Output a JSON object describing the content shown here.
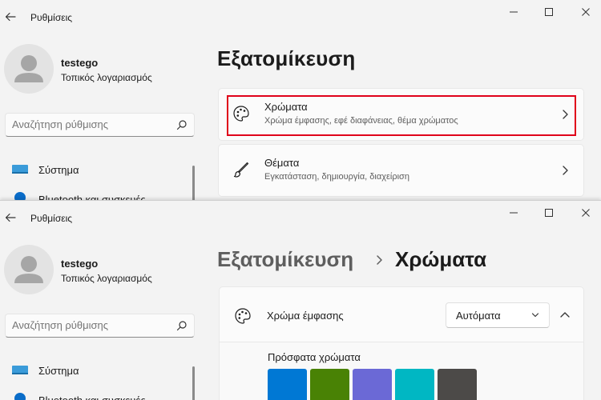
{
  "app_title": "Ρυθμίσεις",
  "user": {
    "name": "testego",
    "account_type": "Τοπικός λογαριασμός"
  },
  "search": {
    "placeholder": "Αναζήτηση ρύθμισης"
  },
  "nav": {
    "items": [
      {
        "label": "Σύστημα",
        "icon": "monitor-icon"
      },
      {
        "label": "Bluetooth και συσκευές",
        "icon": "bluetooth-icon"
      }
    ]
  },
  "top_window": {
    "page_title": "Εξατομίκευση",
    "cards": [
      {
        "title": "Χρώματα",
        "subtitle": "Χρώμα έμφασης, εφέ διαφάνειας, θέμα χρώματος",
        "icon": "palette-icon",
        "highlighted": true
      },
      {
        "title": "Θέματα",
        "subtitle": "Εγκατάσταση, δημιουργία, διαχείριση",
        "icon": "brush-icon",
        "highlighted": false
      }
    ]
  },
  "bottom_window": {
    "breadcrumb": {
      "parent": "Εξατομίκευση",
      "current": "Χρώματα"
    },
    "accent": {
      "label": "Χρώμα έμφασης",
      "dropdown_value": "Αυτόματα",
      "recent_label": "Πρόσφατα χρώματα",
      "swatches": [
        "#0078d4",
        "#498205",
        "#6b69d6",
        "#00b7c3",
        "#4c4a48"
      ]
    }
  },
  "colors": {
    "highlight": "#e0001a",
    "accent": "#0078d4"
  }
}
